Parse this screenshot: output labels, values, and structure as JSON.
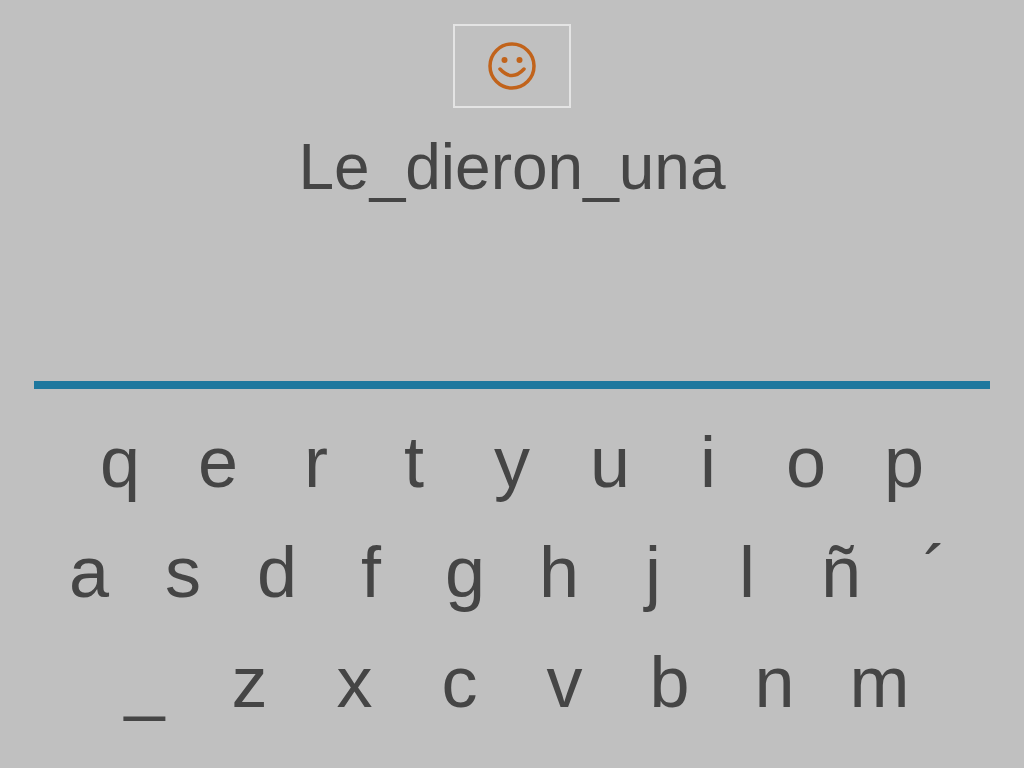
{
  "word": "Le_dieron_una",
  "keyboard": {
    "rows": [
      [
        "q",
        "e",
        "r",
        "t",
        "y",
        "u",
        "i",
        "o",
        "p"
      ],
      [
        "a",
        "s",
        "d",
        "f",
        "g",
        "h",
        "j",
        "l",
        "ñ",
        "´"
      ],
      [
        "_",
        "z",
        "x",
        "c",
        "v",
        "b",
        "n",
        "m"
      ]
    ]
  }
}
